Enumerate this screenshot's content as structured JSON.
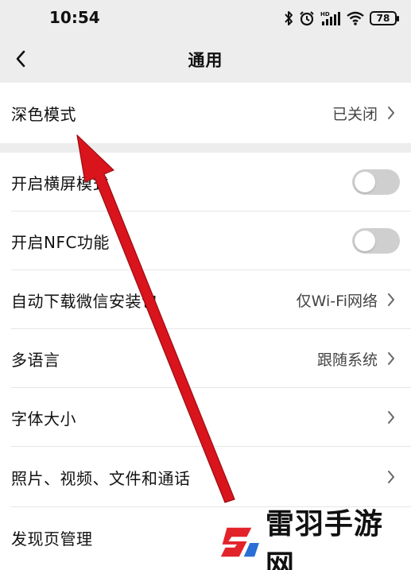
{
  "status_bar": {
    "time": "10:54",
    "battery": "78",
    "icons": [
      "bluetooth-icon",
      "alarm-icon",
      "hd-signal-icon",
      "wifi-icon",
      "battery-icon"
    ]
  },
  "nav": {
    "title": "通用",
    "back_icon": "chevron-left-icon"
  },
  "settings": {
    "dark_mode": {
      "label": "深色模式",
      "value": "已关闭"
    },
    "landscape": {
      "label": "开启横屏模式",
      "enabled": false
    },
    "nfc": {
      "label": "开启NFC功能",
      "enabled": false
    },
    "auto_download": {
      "label": "自动下载微信安装包",
      "value": "仅Wi-Fi网络"
    },
    "language": {
      "label": "多语言",
      "value": "跟随系统"
    },
    "font_size": {
      "label": "字体大小"
    },
    "media": {
      "label": "照片、视频、文件和通话"
    },
    "discover": {
      "label": "发现页管理"
    }
  },
  "watermark": {
    "text": "雷羽手游网"
  },
  "colors": {
    "page_bg": "#ededed",
    "row_bg": "#ffffff",
    "toggle_off": "#cfcfcf",
    "annotation_arrow": "#d9141c"
  }
}
